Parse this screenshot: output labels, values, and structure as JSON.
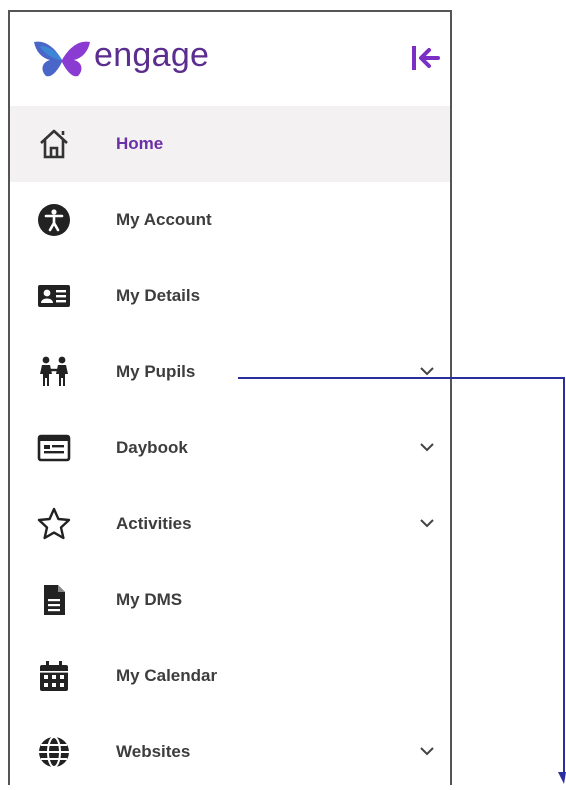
{
  "brand": {
    "name": "engage",
    "primary_color": "#5b2d8e",
    "accent_color": "#3a7bd5"
  },
  "header": {
    "collapse_icon": "collapse-left-icon"
  },
  "nav": {
    "items": [
      {
        "label": "Home",
        "icon": "home-icon",
        "active": true,
        "expandable": false
      },
      {
        "label": "My Account",
        "icon": "accessibility-icon",
        "active": false,
        "expandable": false
      },
      {
        "label": "My Details",
        "icon": "id-card-icon",
        "active": false,
        "expandable": false
      },
      {
        "label": "My Pupils",
        "icon": "people-icon",
        "active": false,
        "expandable": true
      },
      {
        "label": "Daybook",
        "icon": "daybook-icon",
        "active": false,
        "expandable": true
      },
      {
        "label": "Activities",
        "icon": "star-icon",
        "active": false,
        "expandable": true
      },
      {
        "label": "My DMS",
        "icon": "document-icon",
        "active": false,
        "expandable": false
      },
      {
        "label": "My Calendar",
        "icon": "calendar-icon",
        "active": false,
        "expandable": false
      },
      {
        "label": "Websites",
        "icon": "globe-icon",
        "active": false,
        "expandable": true
      }
    ]
  },
  "annotation_color": "#2b2f9e"
}
